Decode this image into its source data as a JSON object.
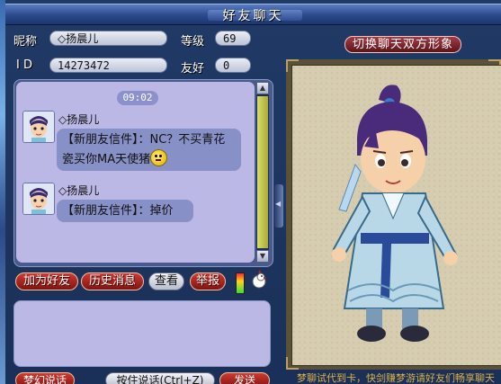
{
  "window": {
    "title": "好友聊天"
  },
  "profile": {
    "nickname_label": "昵称",
    "nickname_value": "◇扬晨儿",
    "level_label": "等级",
    "level_value": "69",
    "id_label": "I D",
    "id_value": "14273472",
    "friendship_label": "友好",
    "friendship_value": "0"
  },
  "switch_button": "切换聊天双方形象",
  "chat": {
    "timestamp": "09:02",
    "messages": [
      {
        "sender": "◇扬晨儿",
        "text": "【新朋友信件】：NC？不买青花瓷买你MA天使猪"
      },
      {
        "sender": "◇扬晨儿",
        "text": "【新朋友信件】：掉价"
      }
    ]
  },
  "actions": {
    "add_friend": "加为好友",
    "history": "历史消息",
    "view": "查看",
    "report": "举报"
  },
  "bottom_bar": {
    "left": "梦幻说话",
    "middle": "按住说话(Ctrl+Z)",
    "send": "发送"
  },
  "ticker": "梦聊试代到卡，快剑赚梦游请好友们畅享聊天"
}
